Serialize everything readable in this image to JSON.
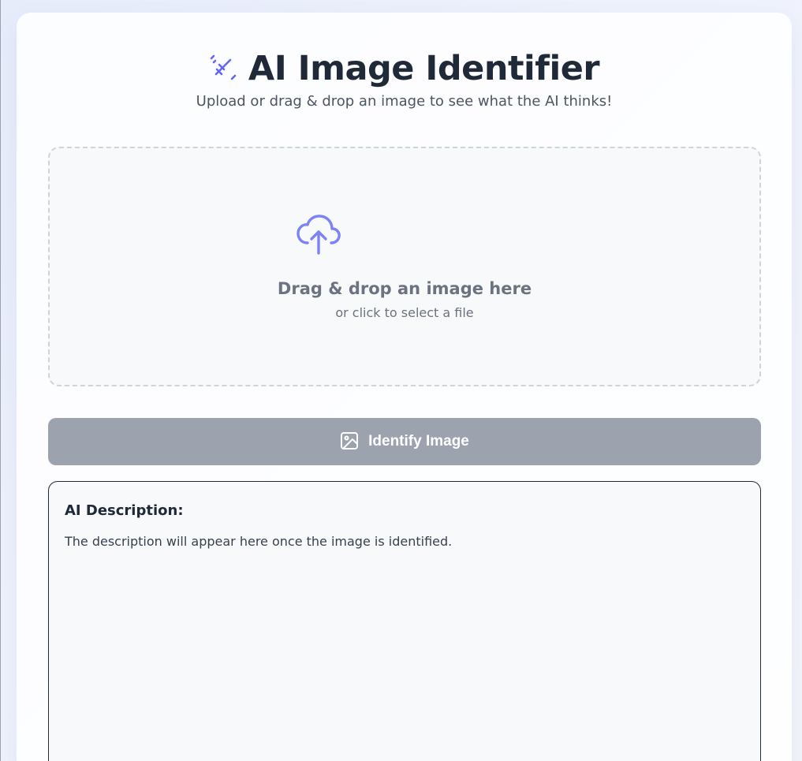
{
  "header": {
    "title": "AI Image Identifier",
    "subtitle": "Upload or drag & drop an image to see what the AI thinks!",
    "icon": "magic-wand-icon"
  },
  "dropzone": {
    "icon": "cloud-upload-icon",
    "main_text": "Drag & drop an image here",
    "sub_text": "or click to select a file"
  },
  "identify_button": {
    "label": "Identify Image",
    "icon": "image-icon",
    "state": "disabled"
  },
  "result": {
    "heading": "AI Description:",
    "placeholder": "The description will appear here once the image is identified."
  },
  "colors": {
    "accent": "#6366f1",
    "title": "#1f2937",
    "button_disabled": "#9ca3af",
    "dropzone_border": "#cfd3dc"
  }
}
